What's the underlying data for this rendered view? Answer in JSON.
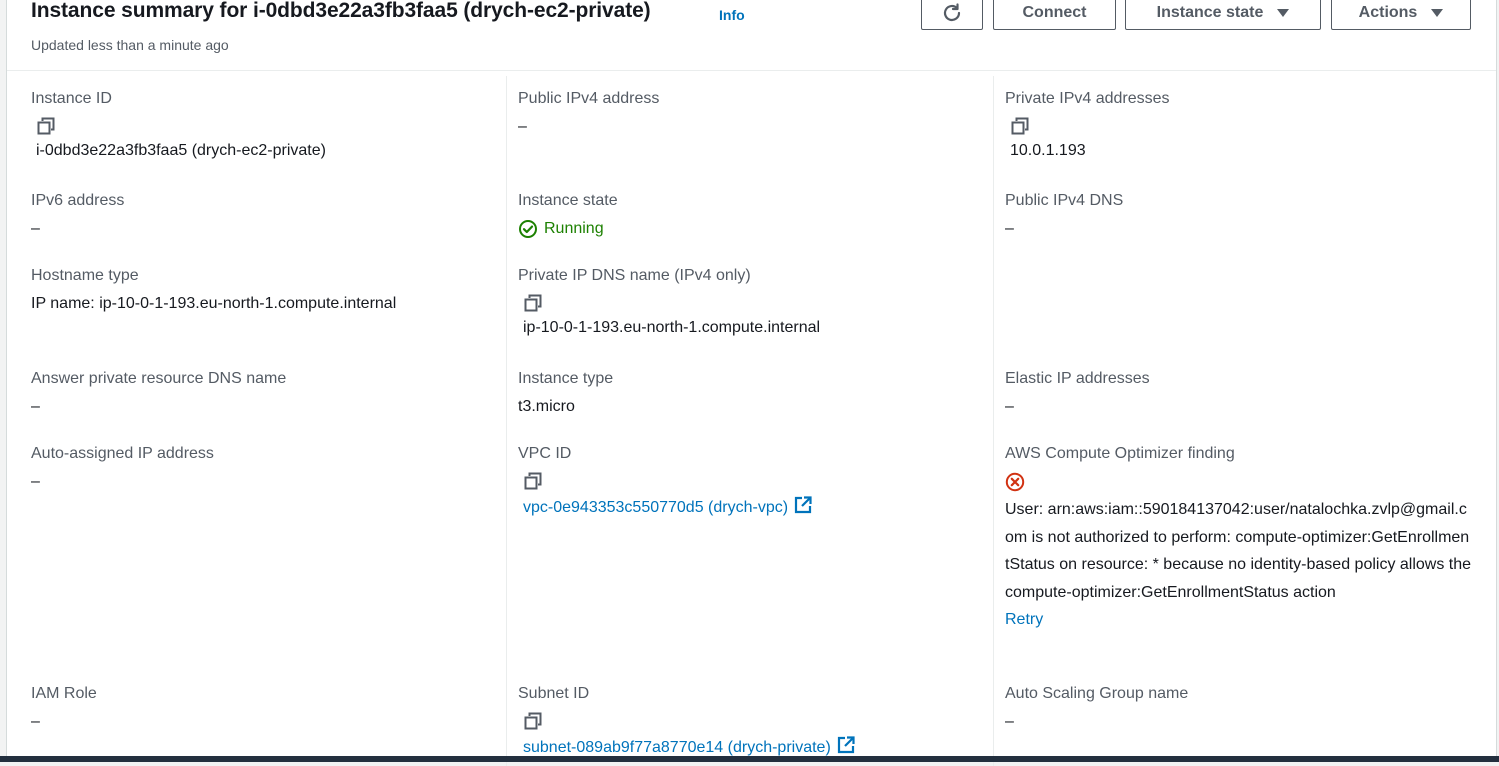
{
  "header": {
    "title": "Instance summary for i-0dbd3e22a3fb3faa5 (drych-ec2-private)",
    "info": "Info",
    "updated": "Updated less than a minute ago",
    "connect_label": "Connect",
    "instance_state_label": "Instance state",
    "actions_label": "Actions"
  },
  "fields": {
    "instance_id": {
      "label": "Instance ID",
      "value": "i-0dbd3e22a3fb3faa5 (drych-ec2-private)"
    },
    "public_ipv4": {
      "label": "Public IPv4 address",
      "value": "–"
    },
    "private_ipv4": {
      "label": "Private IPv4 addresses",
      "value": "10.0.1.193"
    },
    "ipv6": {
      "label": "IPv6 address",
      "value": "–"
    },
    "instance_state": {
      "label": "Instance state",
      "value": "Running"
    },
    "public_dns": {
      "label": "Public IPv4 DNS",
      "value": "–"
    },
    "hostname_type": {
      "label": "Hostname type",
      "value": "IP name: ip-10-0-1-193.eu-north-1.compute.internal"
    },
    "private_dns": {
      "label": "Private IP DNS name (IPv4 only)",
      "value": "ip-10-0-1-193.eu-north-1.compute.internal"
    },
    "answer_private_dns": {
      "label": "Answer private resource DNS name",
      "value": "–"
    },
    "instance_type": {
      "label": "Instance type",
      "value": "t3.micro"
    },
    "elastic_ip": {
      "label": "Elastic IP addresses",
      "value": "–"
    },
    "auto_assigned_ip": {
      "label": "Auto-assigned IP address",
      "value": "–"
    },
    "vpc_id": {
      "label": "VPC ID",
      "value": "vpc-0e943353c550770d5 (drych-vpc)"
    },
    "compute_optimizer": {
      "label": "AWS Compute Optimizer finding",
      "error": "User: arn:aws:iam::590184137042:user/natalochka.zvlp@gmail.com is not authorized to perform: compute-optimizer:GetEnrollmentStatus on resource: * because no identity-based policy allows the compute-optimizer:GetEnrollmentStatus action",
      "retry": "Retry"
    },
    "iam_role": {
      "label": "IAM Role",
      "value": "–"
    },
    "subnet_id": {
      "label": "Subnet ID",
      "value": "subnet-089ab9f77a8770e14 (drych-private)"
    },
    "asg_name": {
      "label": "Auto Scaling Group name",
      "value": "–"
    }
  },
  "colors": {
    "link": "#0073bb",
    "success": "#1d8102",
    "error": "#d13212",
    "label": "#545b64",
    "text": "#16191f"
  },
  "icons": {
    "copy": "copy-icon",
    "external": "external-link-icon",
    "status_ok": "status-positive-icon",
    "status_error": "status-negative-icon",
    "refresh": "refresh-icon",
    "caret": "caret-down-icon"
  }
}
